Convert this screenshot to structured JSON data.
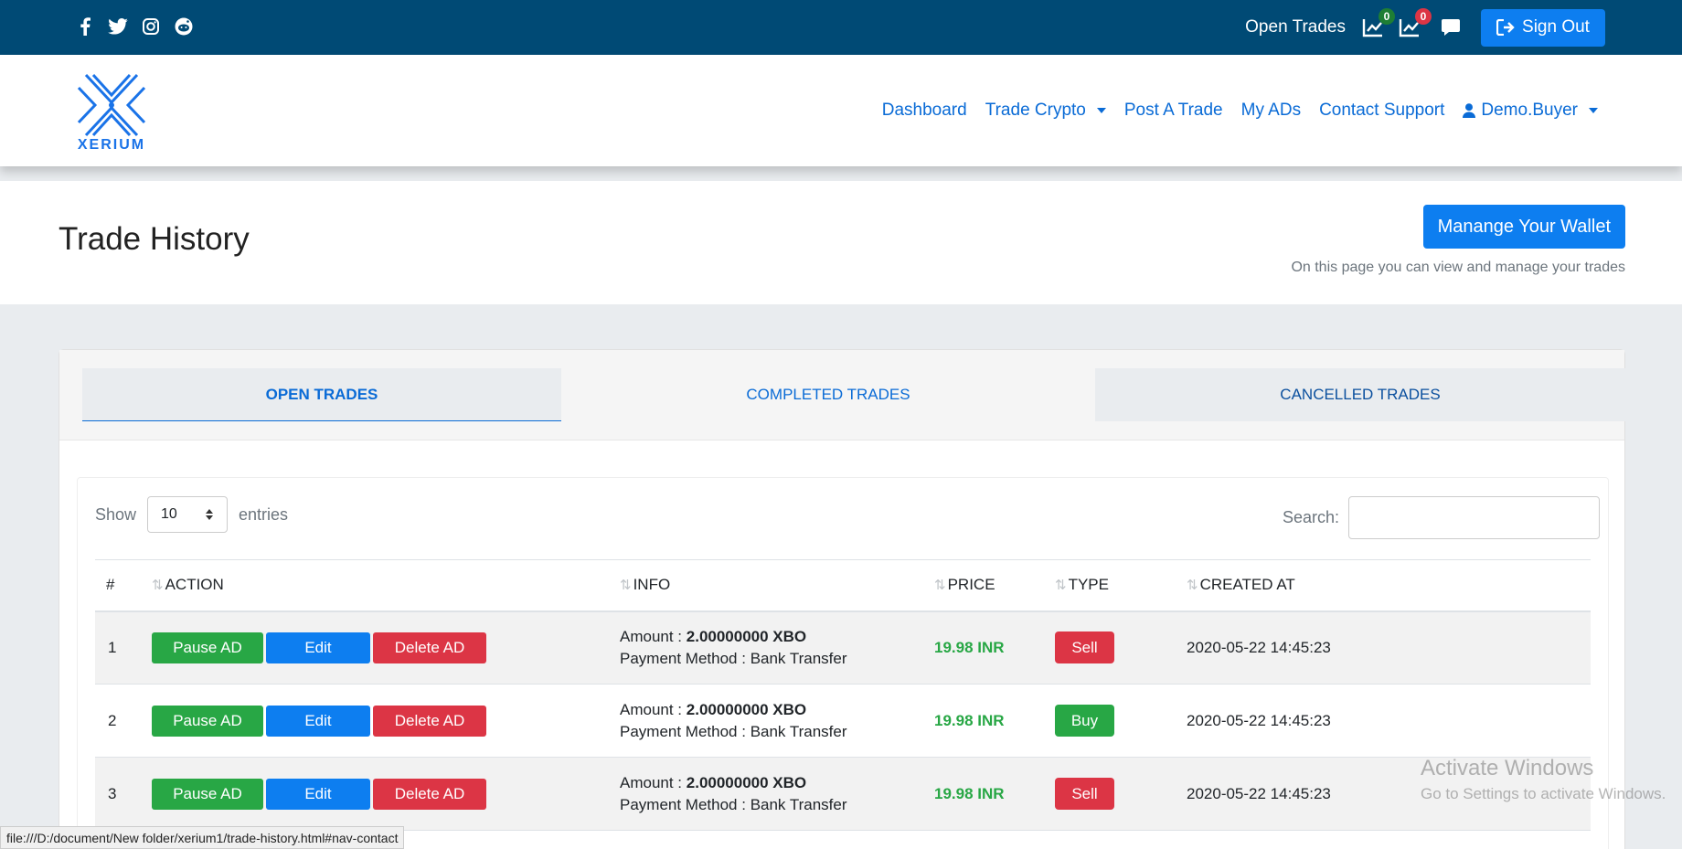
{
  "topbar": {
    "social_icons": [
      "facebook-icon",
      "twitter-icon",
      "instagram-icon",
      "reddit-icon"
    ],
    "open_trades_label": "Open Trades",
    "buy_trades_count": "0",
    "sell_trades_count": "0",
    "sign_out_label": "Sign Out"
  },
  "nav": {
    "logo_text": "XERIUM",
    "dashboard": "Dashboard",
    "trade_crypto": "Trade Crypto",
    "post_trade": "Post A Trade",
    "my_ads": "My ADs",
    "contact_support": "Contact Support",
    "user": "Demo.Buyer"
  },
  "header": {
    "title": "Trade History",
    "wallet_button": "Manange Your Wallet",
    "subtitle": "On this page you can view and manage your trades"
  },
  "tabs": {
    "open": "OPEN TRADES",
    "completed": "COMPLETED TRADES",
    "cancelled": "CANCELLED TRADES"
  },
  "table_controls": {
    "show_label": "Show",
    "entries_value": "10",
    "entries_label": "entries",
    "search_label": "Search:"
  },
  "table": {
    "headers": [
      "#",
      "ACTION",
      "INFO",
      "PRICE",
      "TYPE",
      "CREATED AT"
    ],
    "action_labels": {
      "pause": "Pause AD",
      "edit": "Edit",
      "delete": "Delete AD"
    },
    "info_labels": {
      "amount": "Amount : ",
      "payment": "Payment Method : "
    },
    "rows": [
      {
        "num": "1",
        "amount": "2.00000000 XBO",
        "payment": "Bank Transfer",
        "price": "19.98 INR",
        "type": "Sell",
        "created": "2020-05-22 14:45:23"
      },
      {
        "num": "2",
        "amount": "2.00000000 XBO",
        "payment": "Bank Transfer",
        "price": "19.98 INR",
        "type": "Buy",
        "created": "2020-05-22 14:45:23"
      },
      {
        "num": "3",
        "amount": "2.00000000 XBO",
        "payment": "Bank Transfer",
        "price": "19.98 INR",
        "type": "Sell",
        "created": "2020-05-22 14:45:23"
      }
    ]
  },
  "status_bar": {
    "url": "file:///D:/document/New folder/xerium1/trade-history.html#nav-contact"
  },
  "watermark": {
    "line1": "Activate Windows",
    "line2": "Go to Settings to activate Windows."
  },
  "colors": {
    "topbar": "#004a75",
    "primary": "#0d7ef0",
    "success": "#28a745",
    "danger": "#dc3545"
  }
}
